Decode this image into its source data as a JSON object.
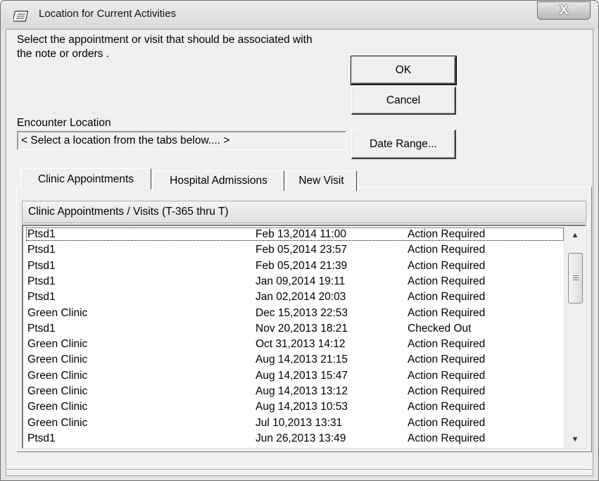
{
  "window": {
    "title": "Location for Current Activities",
    "close_label": "X",
    "icon": "notebook-icon"
  },
  "instruction": "Select the appointment or visit that should be associated with the note or orders .",
  "buttons": {
    "ok": "OK",
    "cancel": "Cancel",
    "date_range": "Date Range..."
  },
  "encounter": {
    "label": "Encounter Location",
    "value": "< Select a location from the tabs below.... >"
  },
  "tabs": [
    {
      "label": "Clinic Appointments",
      "active": true
    },
    {
      "label": "Hospital Admissions",
      "active": false
    },
    {
      "label": "New Visit",
      "active": false
    }
  ],
  "list": {
    "header": "Clinic Appointments / Visits  (T-365 thru T)",
    "rows": [
      {
        "location": "Ptsd1",
        "datetime": "Feb 13,2014 11:00",
        "status": "Action Required"
      },
      {
        "location": "Ptsd1",
        "datetime": "Feb 05,2014 23:57",
        "status": "Action Required"
      },
      {
        "location": "Ptsd1",
        "datetime": "Feb 05,2014 21:39",
        "status": "Action Required"
      },
      {
        "location": "Ptsd1",
        "datetime": "Jan 09,2014 19:11",
        "status": "Action Required"
      },
      {
        "location": "Ptsd1",
        "datetime": "Jan 02,2014 20:03",
        "status": "Action Required"
      },
      {
        "location": "Green Clinic",
        "datetime": "Dec 15,2013 22:53",
        "status": "Action Required"
      },
      {
        "location": "Ptsd1",
        "datetime": "Nov 20,2013 18:21",
        "status": "Checked Out"
      },
      {
        "location": "Green Clinic",
        "datetime": "Oct 31,2013 14:12",
        "status": "Action Required"
      },
      {
        "location": "Green Clinic",
        "datetime": "Aug 14,2013 21:15",
        "status": "Action Required"
      },
      {
        "location": "Green Clinic",
        "datetime": "Aug 14,2013 15:47",
        "status": "Action Required"
      },
      {
        "location": "Green Clinic",
        "datetime": "Aug 14,2013 13:12",
        "status": "Action Required"
      },
      {
        "location": "Green Clinic",
        "datetime": "Aug 14,2013 10:53",
        "status": "Action Required"
      },
      {
        "location": "Green Clinic",
        "datetime": "Jul 10,2013 13:31",
        "status": "Action Required"
      },
      {
        "location": "Ptsd1",
        "datetime": "Jun 26,2013 13:49",
        "status": "Action Required"
      }
    ]
  }
}
